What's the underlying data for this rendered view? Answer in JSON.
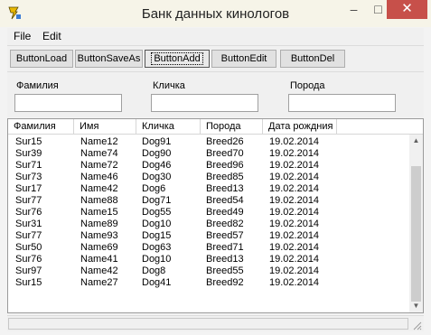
{
  "window": {
    "title": "Банк данных кинологов",
    "controls": {
      "minimize": "–",
      "maximize": "□",
      "close": "✕"
    }
  },
  "menu": [
    "File",
    "Edit"
  ],
  "toolbar": {
    "load": "ButtonLoad",
    "save_as": "ButtonSaveAs",
    "add": "ButtonAdd",
    "edit": "ButtonEdit",
    "delete": "ButtonDel"
  },
  "filters": {
    "surname_label": "Фамилия",
    "nickname_label": "Кличка",
    "breed_label": "Порода",
    "surname_value": "",
    "nickname_value": "",
    "breed_value": ""
  },
  "table": {
    "columns": [
      "Фамилия",
      "Имя",
      "Кличка",
      "Порода",
      "Дата рождния"
    ],
    "rows": [
      [
        "Sur15",
        "Name12",
        "Dog91",
        "Breed26",
        "19.02.2014"
      ],
      [
        "Sur39",
        "Name74",
        "Dog90",
        "Breed70",
        "19.02.2014"
      ],
      [
        "Sur71",
        "Name72",
        "Dog46",
        "Breed96",
        "19.02.2014"
      ],
      [
        "Sur73",
        "Name46",
        "Dog30",
        "Breed85",
        "19.02.2014"
      ],
      [
        "Sur17",
        "Name42",
        "Dog6",
        "Breed13",
        "19.02.2014"
      ],
      [
        "Sur77",
        "Name88",
        "Dog71",
        "Breed54",
        "19.02.2014"
      ],
      [
        "Sur76",
        "Name15",
        "Dog55",
        "Breed49",
        "19.02.2014"
      ],
      [
        "Sur31",
        "Name89",
        "Dog10",
        "Breed82",
        "19.02.2014"
      ],
      [
        "Sur77",
        "Name93",
        "Dog15",
        "Breed57",
        "19.02.2014"
      ],
      [
        "Sur50",
        "Name69",
        "Dog63",
        "Breed71",
        "19.02.2014"
      ],
      [
        "Sur76",
        "Name41",
        "Dog10",
        "Breed13",
        "19.02.2014"
      ],
      [
        "Sur97",
        "Name42",
        "Dog8",
        "Breed55",
        "19.02.2014"
      ],
      [
        "Sur15",
        "Name27",
        "Dog41",
        "Breed92",
        "19.02.2014"
      ]
    ]
  },
  "scrollbar": {
    "up_icon": "arrow-up-icon",
    "down_icon": "arrow-down-icon"
  },
  "statusbar": {
    "text": ""
  }
}
